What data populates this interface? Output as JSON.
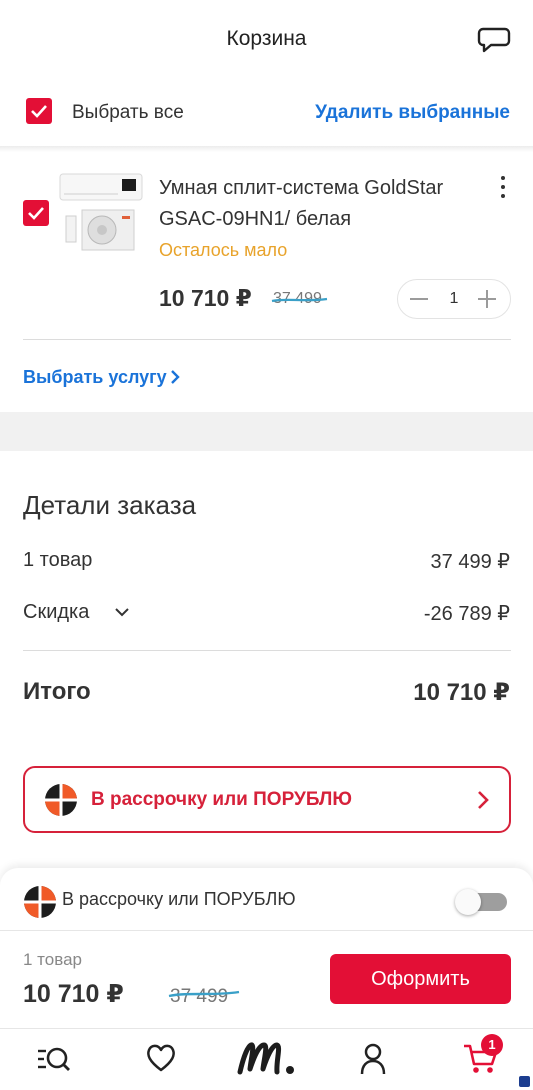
{
  "header": {
    "title": "Корзина",
    "chat_icon": "chat-bubble-icon"
  },
  "selection": {
    "select_all_label": "Выбрать все",
    "delete_selected_label": "Удалить выбранные",
    "select_all_checked": true
  },
  "cart_item": {
    "checked": true,
    "title": "Умная сплит-система GoldStar GSAC-09HN1/ белая",
    "stock_note": "Осталось мало",
    "price": "10 710 ₽",
    "old_price": "37 499",
    "quantity": "1",
    "service_link": "Выбрать услугу"
  },
  "order_details": {
    "title": "Детали заказа",
    "rows": [
      {
        "label": "1 товар",
        "value": "37 499 ₽"
      },
      {
        "label": "Скидка",
        "value": "-26 789 ₽"
      }
    ],
    "total_label": "Итого",
    "total_value": "10 710 ₽"
  },
  "installment": {
    "button_label": "В рассрочку или ПОРУБЛЮ",
    "toggle_label": "В рассрочку или ПОРУБЛЮ",
    "toggle_on": false
  },
  "summary": {
    "count": "1 товар",
    "price": "10 710 ₽",
    "old_price": "37 499",
    "checkout_label": "Оформить"
  },
  "tabbar": {
    "items": [
      "catalog-search-icon",
      "heart-icon",
      "m-logo-icon",
      "profile-icon",
      "cart-icon"
    ],
    "cart_badge": "1"
  },
  "colors": {
    "accent_red": "#e30f36",
    "link_blue": "#1a73d9",
    "warning_orange": "#e8a32b"
  }
}
